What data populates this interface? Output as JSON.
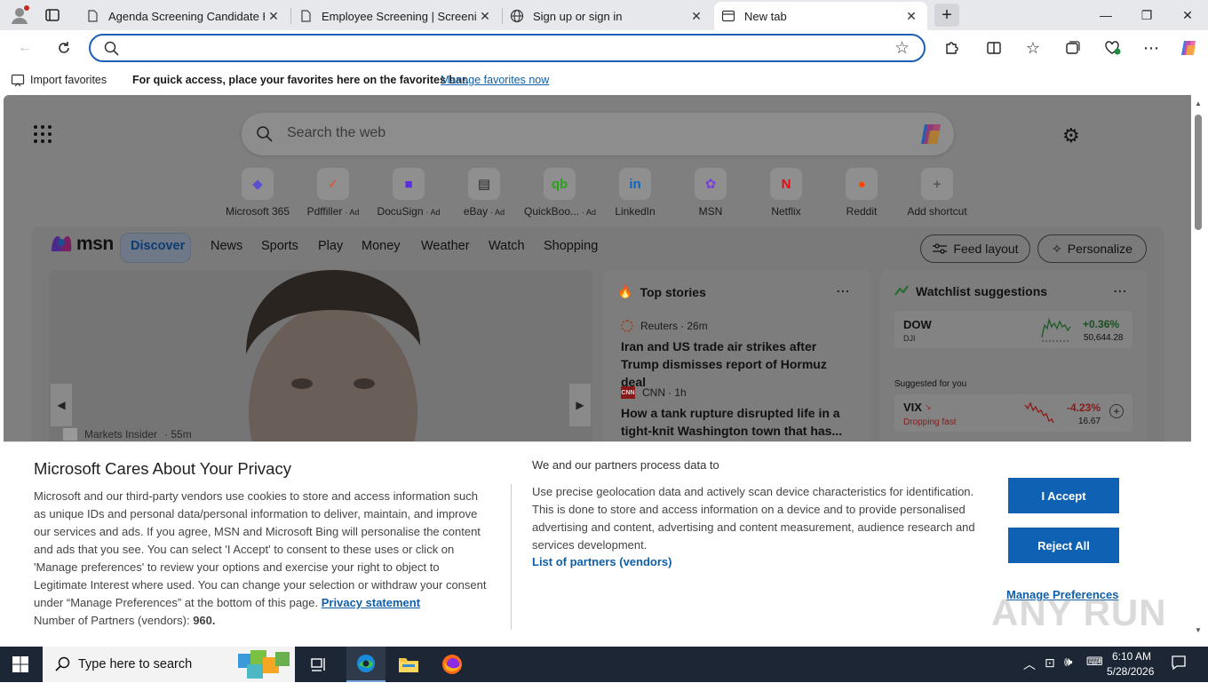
{
  "tabs": [
    {
      "title": "Agenda Screening Candidate Hub"
    },
    {
      "title": "Employee Screening | Screening S"
    },
    {
      "title": "Sign up or sign in"
    },
    {
      "title": "New tab"
    }
  ],
  "address": {
    "value": "",
    "placeholder": ""
  },
  "favorites_bar": {
    "import_label": "Import favorites",
    "hint": "For quick access, place your favorites here on the favorites bar.",
    "manage_link": "Manage favorites now"
  },
  "ntp": {
    "search_placeholder": "Search the web",
    "shortcuts": [
      {
        "label": "Microsoft 365",
        "ad": "",
        "icon": "m365-icon",
        "glyph": "◆",
        "color": "#5a4fcf"
      },
      {
        "label": "Pdffiller",
        "ad": "· Ad",
        "icon": "pdffiller-icon",
        "glyph": "✓",
        "color": "#e8502d"
      },
      {
        "label": "DocuSign",
        "ad": "· Ad",
        "icon": "docusign-icon",
        "glyph": "■",
        "color": "#5a2de0"
      },
      {
        "label": "eBay",
        "ad": "· Ad",
        "icon": "ebay-icon",
        "glyph": "▤",
        "color": "#222222"
      },
      {
        "label": "QuickBoo...",
        "ad": "· Ad",
        "icon": "quickbooks-icon",
        "glyph": "qb",
        "color": "#2ca01c"
      },
      {
        "label": "LinkedIn",
        "ad": "",
        "icon": "linkedin-icon",
        "glyph": "in",
        "color": "#0a66c2"
      },
      {
        "label": "MSN",
        "ad": "",
        "icon": "msn-icon",
        "glyph": "✿",
        "color": "#7a3fe0"
      },
      {
        "label": "Netflix",
        "ad": "",
        "icon": "netflix-icon",
        "glyph": "N",
        "color": "#e50914"
      },
      {
        "label": "Reddit",
        "ad": "",
        "icon": "reddit-icon",
        "glyph": "●",
        "color": "#ff4500"
      },
      {
        "label": "Add shortcut",
        "ad": "",
        "icon": "plus-icon",
        "glyph": "+",
        "color": "#555555"
      }
    ]
  },
  "msn": {
    "logo": "msn",
    "nav": [
      "Discover",
      "News",
      "Sports",
      "Play",
      "Money",
      "Weather",
      "Watch",
      "Shopping"
    ],
    "feed_layout": "Feed layout",
    "personalize": "Personalize",
    "hero_source": "Markets Insider",
    "hero_time": "· 55m",
    "top_stories": {
      "title": "Top stories",
      "items": [
        {
          "source": "Reuters",
          "time": "· 26m",
          "headline": "Iran and US trade air strikes after Trump dismisses report of Hormuz deal"
        },
        {
          "source": "CNN",
          "time": "· 1h",
          "headline": "How a tank rupture disrupted life in a tight-knit Washington town that has..."
        }
      ]
    },
    "watchlist": {
      "title": "Watchlist suggestions",
      "dow": {
        "name": "DOW",
        "sub": "DJI",
        "change": "+0.36%",
        "value": "50,644.28"
      },
      "suggested_label": "Suggested for you",
      "vix": {
        "name": "VIX",
        "sub": "Dropping fast",
        "change": "-4.23%",
        "value": "16.67"
      }
    }
  },
  "privacy": {
    "title": "Microsoft Cares About Your Privacy",
    "body": "Microsoft and our third-party vendors use cookies to store and access information such as unique IDs and personal data/personal information to deliver, maintain, and improve our services and ads. If you agree, MSN and Microsoft Bing will personalise the content and ads that you see. You can select 'I Accept' to consent to these uses or click on 'Manage preferences' to review your options and exercise your right to object to Legitimate Interest where used. You can change your selection or withdraw your consent under “Manage Preferences” at the bottom of this page.",
    "privacy_link": "Privacy statement",
    "partners_label": "Number of Partners (vendors):",
    "partners_count": "960.",
    "right_title": "We and our partners process data to",
    "right_body": "Use precise geolocation data and actively scan device characteristics for identification. This is done to store and access information on a device and to provide personalised advertising and content, advertising and content measurement, audience research and services development.",
    "partners_link": "List of partners (vendors)",
    "accept": "I Accept",
    "reject": "Reject All",
    "manage": "Manage Preferences"
  },
  "watermark": "ANY RUN",
  "taskbar": {
    "search_placeholder": "Type here to search",
    "time": "6:10 AM",
    "date": "5/28/2026"
  }
}
